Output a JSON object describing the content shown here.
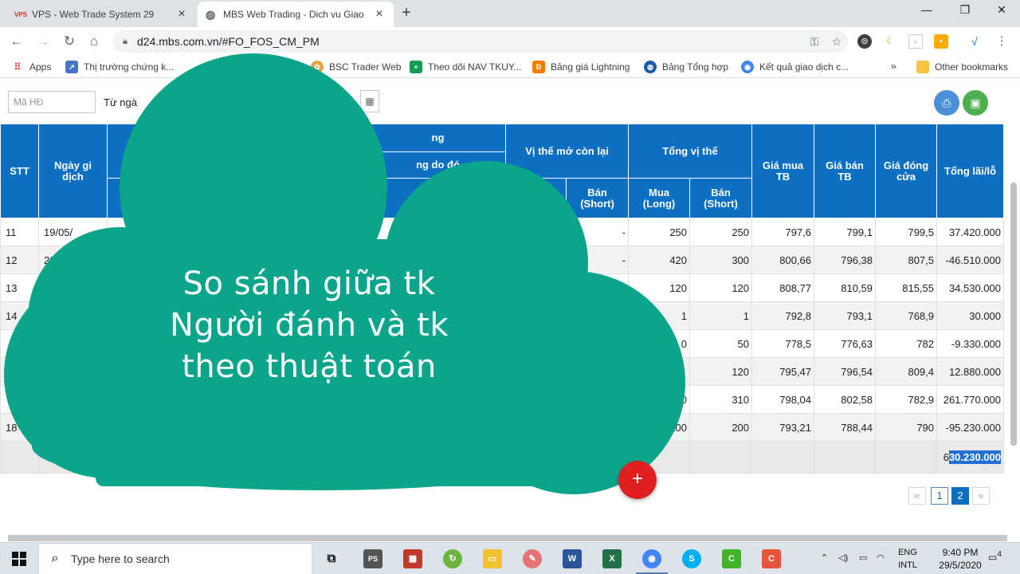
{
  "browser": {
    "tabs": [
      {
        "title": "VPS - Web Trade System 29",
        "favicon": "VPS",
        "active": false
      },
      {
        "title": "MBS Web Trading - Dich vu Giao",
        "favicon": "globe-icon",
        "active": true
      }
    ],
    "url": "d24.mbs.com.vn/#FO_FOS_CM_PM",
    "bookmarks": [
      {
        "label": "Apps",
        "icon": "apps-grid-icon"
      },
      {
        "label": "Thị trường chứng k...",
        "icon": "chart-icon"
      },
      {
        "label": "BSC Trader Web",
        "icon": "bsc-icon"
      },
      {
        "label": "Theo dõi NAV TKUY...",
        "icon": "sheets-icon"
      },
      {
        "label": "Bảng giá Lightning",
        "icon": "lightning-icon"
      },
      {
        "label": "Bảng Tổng hợp",
        "icon": "globe-icon"
      },
      {
        "label": "Kết quả giao dịch c...",
        "icon": "chrome-icon"
      }
    ],
    "bookmarks_overflow": "»",
    "other_bookmarks": "Other bookmarks"
  },
  "filters": {
    "contract_placeholder": "Mã HĐ",
    "from_date_label": "Từ ngà"
  },
  "table": {
    "headers": {
      "stt": "STT",
      "trade_date": "Ngày gi dịch",
      "group_partial": "ng",
      "closed_partial": "ng do đó",
      "open_position": "Vị thế mở còn lại",
      "total_position": "Tổng vị thế",
      "avg_buy": "Giá mua TB",
      "avg_sell": "Giá bán TB",
      "close_price": "Giá đóng cửa",
      "pnl": "Tổng lãi/lỗ",
      "sub_buy_partial": "a",
      "sub_sell_short": "Bán (Short)",
      "sub_buy_long": "Mua (Long)",
      "sub_sell_short2": "Bán (Short)"
    },
    "rows": [
      {
        "stt": "11",
        "date": "19/05/",
        "open_short": "-",
        "total_long": "250",
        "total_short": "250",
        "avg_buy": "797,6",
        "avg_sell": "799,1",
        "close": "799,5",
        "pnl": "37.420.000"
      },
      {
        "stt": "12",
        "date": "20/05/",
        "open_short": "-",
        "total_long": "420",
        "total_short": "300",
        "avg_buy": "800,66",
        "avg_sell": "796,38",
        "close": "807,5",
        "pnl": "-46.510.000"
      },
      {
        "stt": "13",
        "date": "",
        "open_short": "",
        "total_long": "120",
        "total_short": "120",
        "avg_buy": "808,77",
        "avg_sell": "810,59",
        "close": "815,55",
        "pnl": "34.530.000"
      },
      {
        "stt": "14",
        "date": "",
        "open_short": "",
        "total_long": "1",
        "total_short": "1",
        "avg_buy": "792,8",
        "avg_sell": "793,1",
        "close": "768,9",
        "pnl": "30.000"
      },
      {
        "stt": "",
        "date": "",
        "open_short": "",
        "total_long": "0",
        "total_short": "50",
        "avg_buy": "778,5",
        "avg_sell": "776,63",
        "close": "782",
        "pnl": "-9.330.000"
      },
      {
        "stt": "",
        "date": "",
        "open_short": "",
        "total_long": "",
        "total_short": "120",
        "avg_buy": "795,47",
        "avg_sell": "796,54",
        "close": "809,4",
        "pnl": "12.880.000"
      },
      {
        "stt": "",
        "date": "",
        "open_short": "",
        "total_long": "0",
        "total_short": "310",
        "avg_buy": "798,04",
        "avg_sell": "802,58",
        "close": "782,9",
        "pnl": "261.770.000"
      },
      {
        "stt": "18",
        "date": "",
        "open_short": "",
        "total_long": "200",
        "total_short": "200",
        "avg_buy": "793,21",
        "avg_sell": "788,44",
        "close": "790",
        "pnl": "-95.230.000"
      }
    ],
    "total_prefix": "6",
    "total_highlight": "30.230.000"
  },
  "pagination": {
    "prev": "«",
    "pages": [
      "1",
      "2"
    ],
    "current": "2",
    "next": "»"
  },
  "fab_label": "+",
  "overlay_text": [
    "So sánh giữa tk",
    "Người đánh và tk",
    "theo thuật toán"
  ],
  "taskbar": {
    "search_placeholder": "Type here to search",
    "language": [
      "ENG",
      "INTL"
    ],
    "time": "9:40 PM",
    "date": "29/5/2020",
    "notification_count": "4"
  },
  "colors": {
    "header_blue": "#0d6fc1",
    "cloud_green": "#0aa58a",
    "fab_red": "#e02020",
    "highlight_blue": "#2270d6"
  }
}
